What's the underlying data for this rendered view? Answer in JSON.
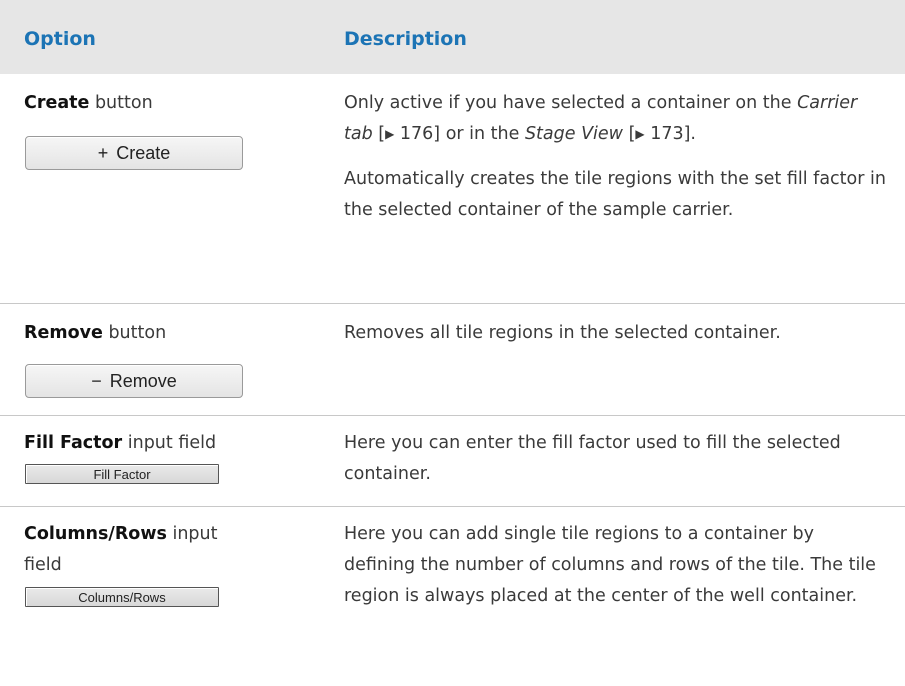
{
  "header": {
    "option": "Option",
    "description": "Description"
  },
  "rows": [
    {
      "name": "Create",
      "type": " button",
      "control": {
        "glyph": "+",
        "label": "Create"
      },
      "desc": [
        {
          "before": "Only active if you have selected a container on the ",
          "link1": "Carrier tab",
          "ref1": " 176",
          "middle": " or in the ",
          "link2": "Stage View",
          "ref2": " 173",
          "end": "."
        },
        "Automatically creates the tile regions with the set fill factor in the selected container of the sample carrier."
      ]
    },
    {
      "name": "Remove",
      "type": " button",
      "control": {
        "glyph": "−",
        "label": "Remove"
      },
      "desc": "Removes all tile regions in the selected container."
    },
    {
      "name": "Fill Factor",
      "type": " input field",
      "control": {
        "label": "Fill Factor"
      },
      "desc": "Here you can enter the fill factor used to fill the selected container."
    },
    {
      "name": "Columns/Rows",
      "type": " input",
      "type2": "field",
      "control": {
        "label": "Columns/Rows"
      },
      "desc": "Here you can add single tile regions to a container by defining the number of columns and rows of the tile. The tile region is always placed at the center of the well container."
    }
  ]
}
